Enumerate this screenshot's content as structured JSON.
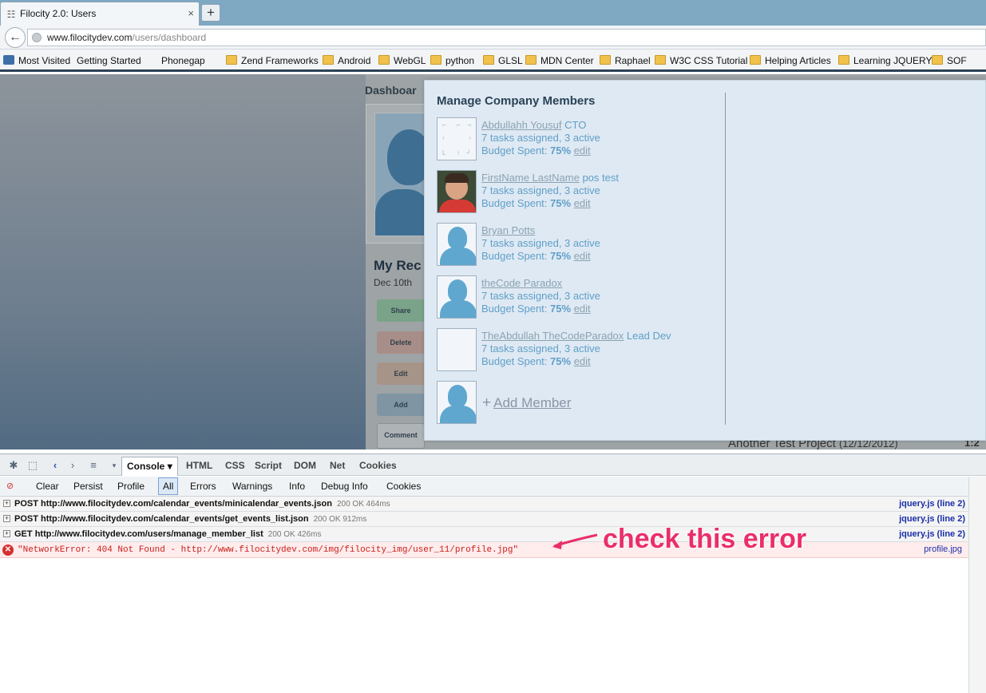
{
  "browser": {
    "tab_title": "Filocity 2.0: Users",
    "tab_close": "×",
    "new_tab": "+",
    "url_host": "www.filocitydev.com",
    "url_path": "/users/dashboard",
    "bookmarks": [
      "Most Visited",
      "Getting Started",
      "Phonegap",
      "Zend Frameworks",
      "Android",
      "WebGL",
      "python",
      "GLSL",
      "MDN Center",
      "Raphael",
      "W3C CSS Tutorial",
      "Helping Articles",
      "Learning JQUERY",
      "SOF"
    ]
  },
  "page": {
    "dashboard_title": "Dashboar",
    "my_rec": "My Rec",
    "date": "Dec 10th",
    "buttons": {
      "share": "Share",
      "delete": "Delete",
      "edit": "Edit",
      "add": "Add",
      "comment": "Comment"
    },
    "under_project": "Another Test Project",
    "under_project_date": "(12/12/2012)",
    "under_time": "1:2"
  },
  "modal": {
    "title": "Manage Company Members",
    "members": [
      {
        "name": "Abdullahh Yousuf",
        "role": "CTO",
        "tasks": "7 tasks assigned, 3 active",
        "budget_label": "Budget Spent:",
        "budget": "75%",
        "edit": "edit"
      },
      {
        "name": "FirstName LastName",
        "role": "pos test",
        "tasks": "7 tasks assigned, 3 active",
        "budget_label": "Budget Spent:",
        "budget": "75%",
        "edit": "edit"
      },
      {
        "name": "Bryan Potts",
        "role": "",
        "tasks": "7 tasks assigned, 3 active",
        "budget_label": "Budget Spent:",
        "budget": "75%",
        "edit": "edit"
      },
      {
        "name": "theCode Paradox",
        "role": "",
        "tasks": "7 tasks assigned, 3 active",
        "budget_label": "Budget Spent:",
        "budget": "75%",
        "edit": "edit"
      },
      {
        "name": "TheAbdullah TheCodeParadox",
        "role": "Lead Dev",
        "tasks": "7 tasks assigned, 3 active",
        "budget_label": "Budget Spent:",
        "budget": "75%",
        "edit": "edit"
      }
    ],
    "add_plus": "+",
    "add_member": "Add Member"
  },
  "firebug": {
    "tabs": [
      "Console",
      "HTML",
      "CSS",
      "Script",
      "DOM",
      "Net",
      "Cookies"
    ],
    "console_arrow": "▾",
    "subtabs": [
      "Clear",
      "Persist",
      "Profile",
      "All",
      "Errors",
      "Warnings",
      "Info",
      "Debug Info",
      "Cookies"
    ],
    "logs": [
      {
        "method": "POST",
        "url": "http://www.filocitydev.com/calendar_events/minicalendar_events.json",
        "status": "200 OK 464ms",
        "src": "jquery.js (line 2)"
      },
      {
        "method": "POST",
        "url": "http://www.filocitydev.com/calendar_events/get_events_list.json",
        "status": "200 OK 912ms",
        "src": "jquery.js (line 2)"
      },
      {
        "method": "GET",
        "url": "http://www.filocitydev.com/users/manage_member_list",
        "status": "200 OK 426ms",
        "src": "jquery.js (line 2)"
      }
    ],
    "error": {
      "text": "\"NetworkError: 404 Not Found - http://www.filocitydev.com/img/filocity_img/user_11/profile.jpg\"",
      "src": "profile.jpg"
    }
  },
  "annotation": "check this error",
  "colors": {
    "accent": "#5f9fc8",
    "error": "#c8201c",
    "annotation": "#ea2e6a"
  }
}
